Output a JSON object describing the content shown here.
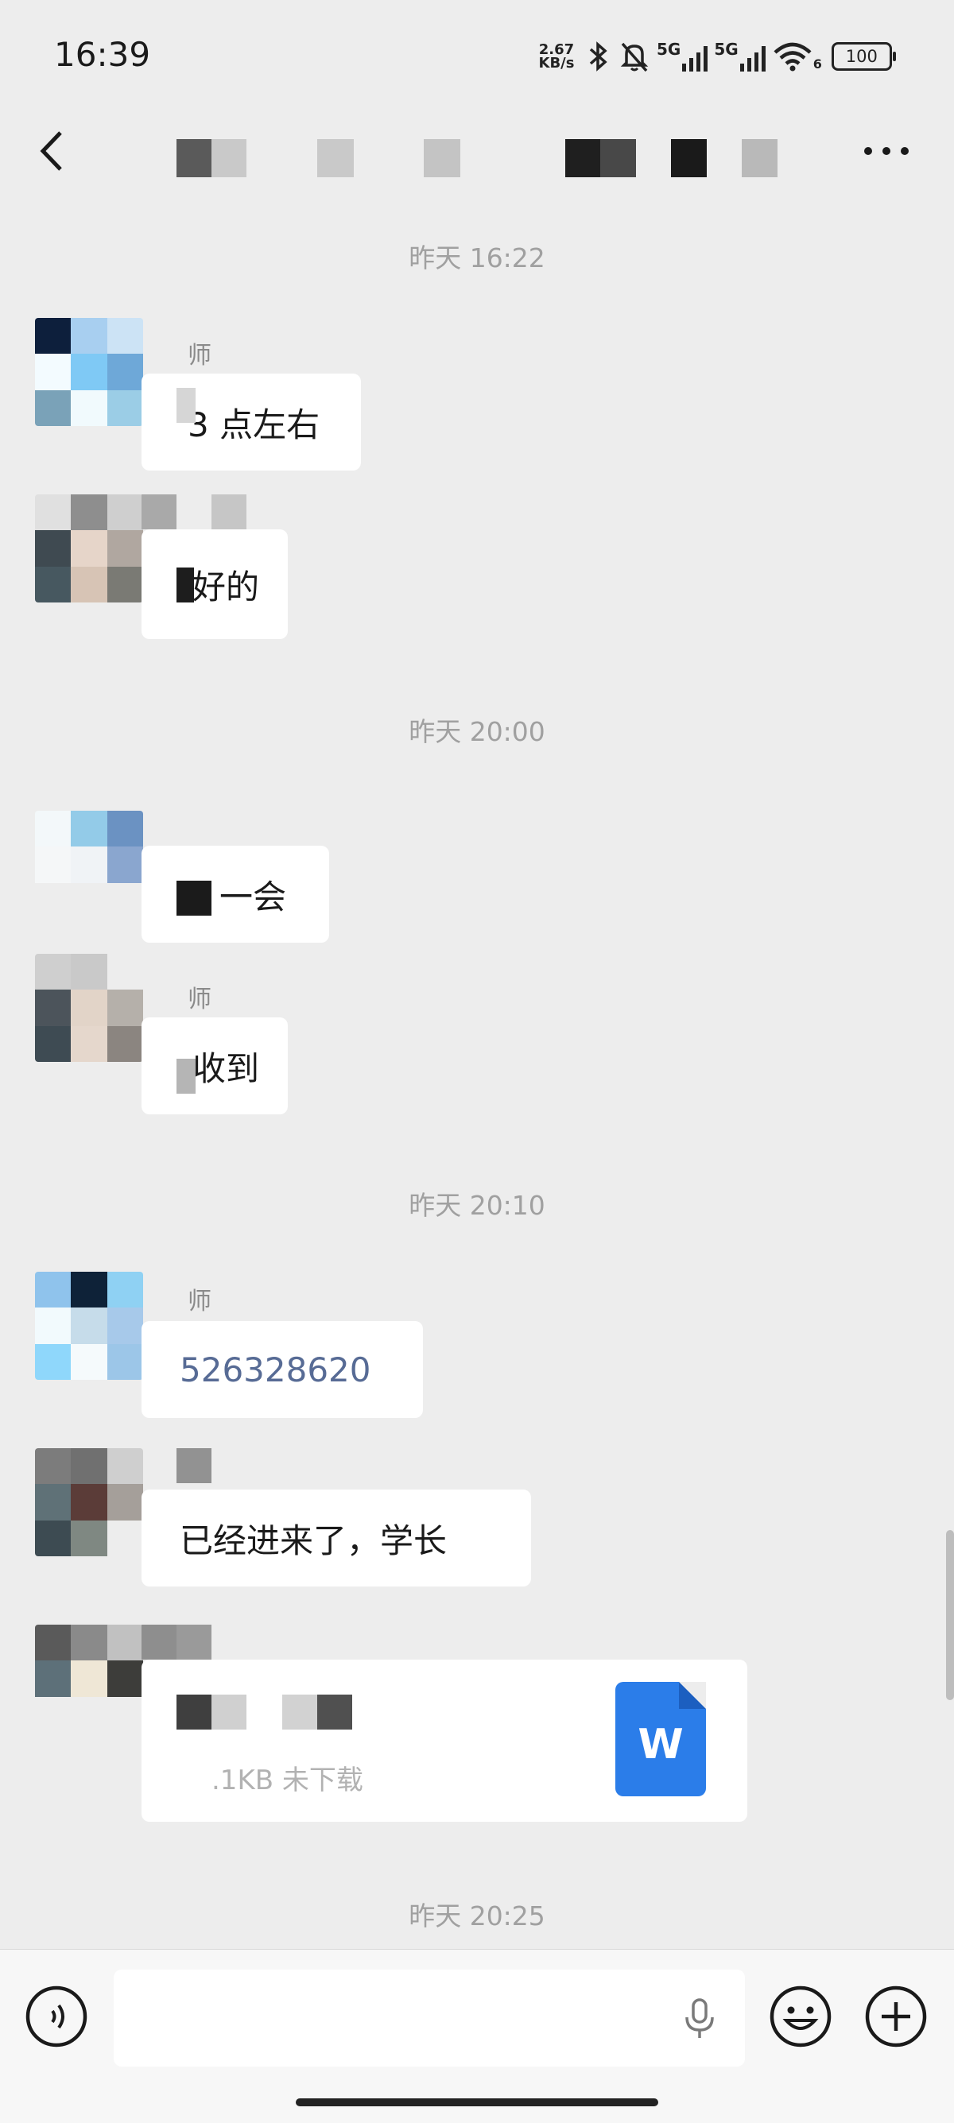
{
  "status_bar": {
    "time": "16:39",
    "net_speed_value": "2.67",
    "net_speed_unit": "KB/s",
    "sig1": "5G",
    "sig2": "5G",
    "wifi_sub": "6",
    "battery": "100"
  },
  "header": {
    "back_icon": "chevron-left-icon",
    "more_icon": "more-dots-icon"
  },
  "messages": [
    {
      "timestamp": "昨天 16:22"
    },
    {
      "sender_fragment": "师",
      "text": "3 点左右"
    },
    {
      "text": "好的"
    },
    {
      "timestamp": "昨天 20:00"
    },
    {
      "text": "一会"
    },
    {
      "sender_fragment": "师",
      "text": "收到"
    },
    {
      "timestamp": "昨天 20:10"
    },
    {
      "sender_fragment": "师",
      "text": "526328620"
    },
    {
      "text": "已经进来了，学长"
    },
    {
      "file_meta": ".1KB  未下载",
      "file_icon_letter": "W"
    },
    {
      "timestamp": "昨天 20:25"
    }
  ],
  "colors": {
    "background": "#ededed",
    "bubble": "#ffffff",
    "link": "#576b95",
    "word_blue": "#2b7de9"
  }
}
